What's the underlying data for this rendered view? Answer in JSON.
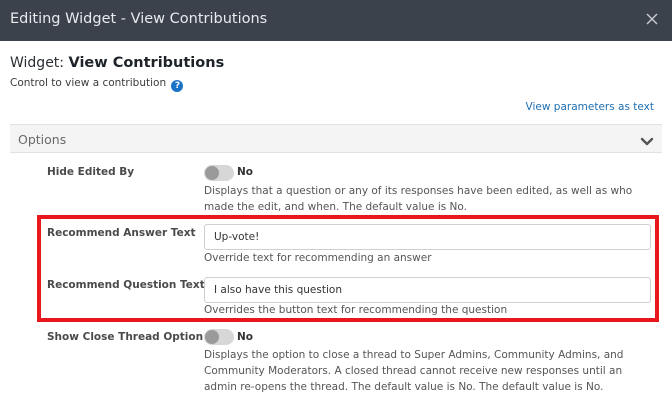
{
  "dialog": {
    "title": "Editing Widget - View Contributions",
    "close_icon": "close-icon"
  },
  "widget": {
    "label": "Widget:",
    "name": "View Contributions",
    "description": "Control to view a contribution",
    "help_icon": "?"
  },
  "links": {
    "view_parameters": "View parameters as text"
  },
  "options": {
    "label": "Options",
    "icon": "chevron-down-icon"
  },
  "fields": {
    "hide_edited_by": {
      "label": "Hide Edited By",
      "toggle_text": "No",
      "toggle_on": false,
      "help": "Displays that a question or any of its responses have been edited, as well as who made the edit, and when. The default value is No."
    },
    "recommend_answer_text": {
      "label": "Recommend Answer Text",
      "value": "Up-vote!",
      "help": "Override text for recommending an answer"
    },
    "recommend_question_text": {
      "label": "Recommend Question Text",
      "value": "I also have this question",
      "help": "Overrides the button text for recommending the question"
    },
    "show_close_thread_option": {
      "label": "Show Close Thread Option",
      "toggle_text": "No",
      "toggle_on": false,
      "help": "Displays the option to close a thread to Super Admins, Community Admins, and Community Moderators. A closed thread cannot receive new responses until an admin re-opens the thread. The default value is No. The default value is No."
    }
  },
  "colors": {
    "titlebar": "#3b424c",
    "link": "#1f6fb2",
    "highlight": "#e8171b",
    "help_icon": "#1a73c7"
  }
}
